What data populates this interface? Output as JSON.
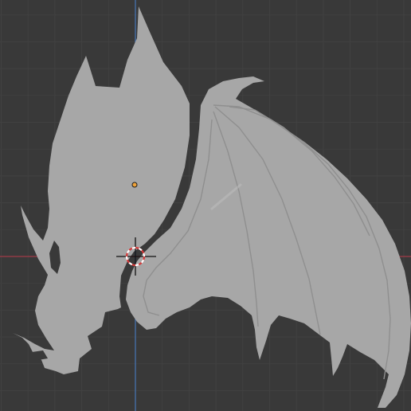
{
  "viewport": {
    "background_color": "#393939",
    "grid_minor_color": "#414141",
    "grid_major_color": "#2e2e2e",
    "x_axis_color": "#a23b47",
    "y_axis_color": "#4777b8"
  },
  "object": {
    "name_hint": "dragon-silhouette",
    "fill_color": "#a7a7a7",
    "edge_color": "#bdbdbd",
    "shadow_color": "#8f8f8f",
    "origin_color": "#f0a33a"
  },
  "cursor_3d": {
    "ring_color_a": "#d43a3a",
    "ring_color_b": "#ffffff",
    "crosshair_color": "#111111"
  }
}
